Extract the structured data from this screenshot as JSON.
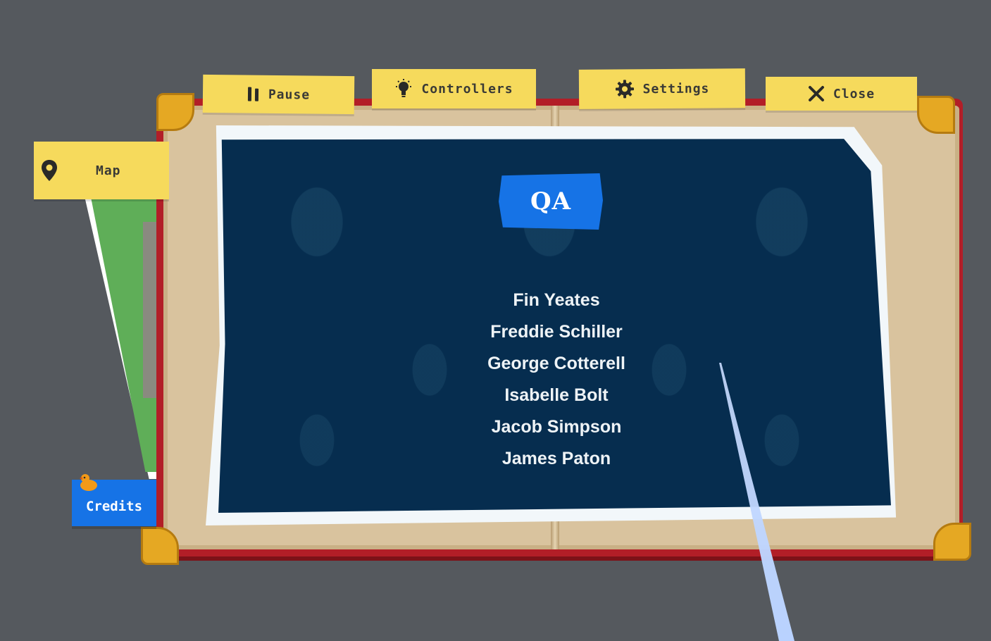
{
  "tabs": {
    "pause": {
      "label": "Pause",
      "icon": "pause-icon"
    },
    "controllers": {
      "label": "Controllers",
      "icon": "lightbulb-icon"
    },
    "settings": {
      "label": "Settings",
      "icon": "gear-icon"
    },
    "close": {
      "label": "Close",
      "icon": "close-icon"
    },
    "map": {
      "label": "Map",
      "icon": "map-pin-icon"
    },
    "credits": {
      "label": "Credits",
      "icon": "duck-icon"
    }
  },
  "credits_page": {
    "section_title": "QA",
    "names": [
      "Fin Yeates",
      "Freddie Schiller",
      "George Cotterell",
      "Isabelle Bolt",
      "Jacob Simpson",
      "James Paton"
    ]
  },
  "colors": {
    "tab_yellow": "#f6da5c",
    "accent_blue": "#1673e6",
    "panel_navy": "#062d4f",
    "book_red": "#b21e27",
    "corner_gold": "#e5a823",
    "background": "#55595e"
  }
}
